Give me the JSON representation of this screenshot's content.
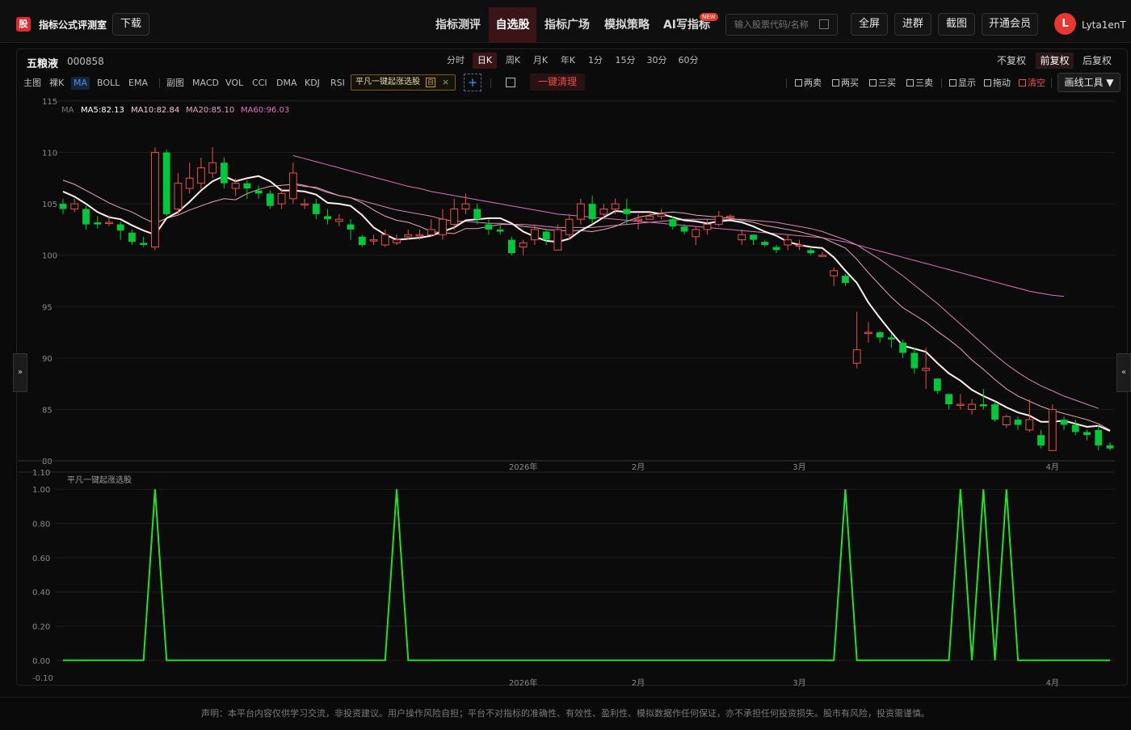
{
  "app": {
    "logo": "股",
    "title": "指标公式评测室",
    "download": "下载"
  },
  "nav": [
    {
      "label": "指标测评",
      "active": false
    },
    {
      "label": "自选股",
      "active": true
    },
    {
      "label": "指标广场",
      "active": false
    },
    {
      "label": "模拟策略",
      "active": false
    },
    {
      "label": "AI写指标",
      "active": false,
      "badge": "NEW"
    }
  ],
  "search": {
    "placeholder": "输入股票代码/名称"
  },
  "header_buttons": {
    "fullscreen": "全屏",
    "join_group": "进群",
    "screenshot": "截图",
    "membership": "开通会员"
  },
  "user": {
    "initial": "L",
    "name": "Lyta1enT"
  },
  "stock": {
    "name": "五粮液",
    "code": "000858"
  },
  "timeframes": [
    "分时",
    "日K",
    "周K",
    "月K",
    "年K",
    "1分",
    "15分",
    "30分",
    "60分"
  ],
  "active_timeframe": "日K",
  "adjust": [
    "不复权",
    "前复权",
    "后复权"
  ],
  "active_adjust": "前复权",
  "indicator_bar": {
    "main_label": "主图",
    "items": [
      "裸K",
      "MA",
      "BOLL",
      "EMA"
    ],
    "active": "MA",
    "sub_label": "副图",
    "sub_items": [
      "MACD",
      "VOL",
      "CCI",
      "DMA",
      "KDJ",
      "RSI"
    ],
    "formula_chip": "平凡一键起涨选股",
    "formula_tag": "自",
    "clear_all": "一键清理"
  },
  "checks": [
    {
      "label": "两卖",
      "red": false
    },
    {
      "label": "两买",
      "red": false
    },
    {
      "label": "三买",
      "red": false
    },
    {
      "label": "三卖",
      "red": false
    },
    {
      "label": "显示",
      "red": false
    },
    {
      "label": "拖动",
      "red": false
    },
    {
      "label": "清空",
      "red": true
    }
  ],
  "draw_tool": "画线工具 ▼",
  "handles": {
    "left": "»",
    "right": "«"
  },
  "colors": {
    "up": "#e8504a",
    "down": "#00c83a",
    "ma5": "#ffeeee",
    "ma10": "#e8a8b8",
    "ma20": "#d888b8",
    "ma60": "#e070c0",
    "signal": "#22e022"
  },
  "chart_data": [
    {
      "type": "candlestick",
      "yticks": [
        80,
        85,
        90,
        95,
        100,
        105,
        110,
        115
      ],
      "ylim": [
        80,
        115
      ],
      "x_labels": [
        {
          "index": 40,
          "label": "2026年"
        },
        {
          "index": 50,
          "label": "2月"
        },
        {
          "index": 64,
          "label": "3月"
        },
        {
          "index": 86,
          "label": "4月"
        }
      ],
      "ma_legend": {
        "label": "MA",
        "items": [
          "MA5:82.13",
          "MA10:82.84",
          "MA20:85.10",
          "MA60:96.03"
        ]
      },
      "candles": [
        [
          105.0,
          104.5,
          105.5,
          104.0
        ],
        [
          104.5,
          105.0,
          105.5,
          104.2
        ],
        [
          104.5,
          103.0,
          104.8,
          102.5
        ],
        [
          103.2,
          103.0,
          103.8,
          102.6
        ],
        [
          103.2,
          103.2,
          103.9,
          102.8
        ],
        [
          103.0,
          102.4,
          103.3,
          101.5
        ],
        [
          102.2,
          101.3,
          102.5,
          101.0
        ],
        [
          101.2,
          101.0,
          101.8,
          100.8
        ],
        [
          100.8,
          110.0,
          110.5,
          100.5
        ],
        [
          110.0,
          104.0,
          110.3,
          103.8
        ],
        [
          104.5,
          107.0,
          108.0,
          104.0
        ],
        [
          106.5,
          107.5,
          109.0,
          106.0
        ],
        [
          107.0,
          108.5,
          109.5,
          106.5
        ],
        [
          108.0,
          109.0,
          110.5,
          107.5
        ],
        [
          109.0,
          107.0,
          109.5,
          106.5
        ],
        [
          106.5,
          107.0,
          107.5,
          105.8
        ],
        [
          107.0,
          106.5,
          107.3,
          105.5
        ],
        [
          106.3,
          106.0,
          106.8,
          105.5
        ],
        [
          106.0,
          104.8,
          106.3,
          104.5
        ],
        [
          105.0,
          106.0,
          106.5,
          104.5
        ],
        [
          105.5,
          108.0,
          109.0,
          105.0
        ],
        [
          105.0,
          105.0,
          105.5,
          104.5
        ],
        [
          105.0,
          104.0,
          105.5,
          103.5
        ],
        [
          103.8,
          103.5,
          104.5,
          103.0
        ],
        [
          103.3,
          103.5,
          104.0,
          102.8
        ],
        [
          103.0,
          102.5,
          103.5,
          101.5
        ],
        [
          101.8,
          101.0,
          102.0,
          100.8
        ],
        [
          101.5,
          101.5,
          102.0,
          101.0
        ],
        [
          101.0,
          102.0,
          102.5,
          100.8
        ],
        [
          101.2,
          101.5,
          102.0,
          101.0
        ],
        [
          101.8,
          102.0,
          102.5,
          101.5
        ],
        [
          102.0,
          102.0,
          102.5,
          101.5
        ],
        [
          102.0,
          102.5,
          103.5,
          101.8
        ],
        [
          102.0,
          103.5,
          104.5,
          101.5
        ],
        [
          103.0,
          104.5,
          105.5,
          102.5
        ],
        [
          104.5,
          105.0,
          106.0,
          104.0
        ],
        [
          104.5,
          103.5,
          105.0,
          103.0
        ],
        [
          103.0,
          102.5,
          103.5,
          102.0
        ],
        [
          102.5,
          102.3,
          103.0,
          102.0
        ],
        [
          101.5,
          100.2,
          101.8,
          100.0
        ],
        [
          100.8,
          101.2,
          101.5,
          100.0
        ],
        [
          101.5,
          102.5,
          103.0,
          101.0
        ],
        [
          102.3,
          101.5,
          102.5,
          101.0
        ],
        [
          100.5,
          102.5,
          103.0,
          100.5
        ],
        [
          102.0,
          103.5,
          104.0,
          101.5
        ],
        [
          103.5,
          105.0,
          105.5,
          103.0
        ],
        [
          105.0,
          103.5,
          105.8,
          103.0
        ],
        [
          104.0,
          104.5,
          105.0,
          103.5
        ],
        [
          104.5,
          105.0,
          105.5,
          104.0
        ],
        [
          104.5,
          104.0,
          105.5,
          103.0
        ],
        [
          103.5,
          103.5,
          104.0,
          102.5
        ],
        [
          103.5,
          103.8,
          104.2,
          103.5
        ],
        [
          103.8,
          104.0,
          104.5,
          103.5
        ],
        [
          103.5,
          102.8,
          103.8,
          102.5
        ],
        [
          102.8,
          102.3,
          103.0,
          102.0
        ],
        [
          101.8,
          102.5,
          102.8,
          101.0
        ],
        [
          102.5,
          103.0,
          103.5,
          102.0
        ],
        [
          103.0,
          103.8,
          104.3,
          102.8
        ],
        [
          103.8,
          103.8,
          104.0,
          103.5
        ],
        [
          101.5,
          102.0,
          102.5,
          101.0
        ],
        [
          102.0,
          101.5,
          102.0,
          101.0
        ],
        [
          101.3,
          101.0,
          101.5,
          100.8
        ],
        [
          100.8,
          100.5,
          101.0,
          100.2
        ],
        [
          101.0,
          101.5,
          102.0,
          100.5
        ],
        [
          101.0,
          101.0,
          101.5,
          100.5
        ],
        [
          100.5,
          100.2,
          100.8,
          100.0
        ],
        [
          100.0,
          100.0,
          100.3,
          99.8
        ],
        [
          98.0,
          98.5,
          98.8,
          97.0
        ],
        [
          98.0,
          97.3,
          98.2,
          97.0
        ],
        [
          89.5,
          90.8,
          94.5,
          89.0
        ],
        [
          92.5,
          92.5,
          93.5,
          91.5
        ],
        [
          92.5,
          92.0,
          92.6,
          91.5
        ],
        [
          92.0,
          91.8,
          92.3,
          91.0
        ],
        [
          91.5,
          90.5,
          91.8,
          90.0
        ],
        [
          90.5,
          89.0,
          91.0,
          88.5
        ],
        [
          88.8,
          89.0,
          91.0,
          87.0
        ],
        [
          88.0,
          86.8,
          88.0,
          86.5
        ],
        [
          86.5,
          85.5,
          86.5,
          85.0
        ],
        [
          85.5,
          85.5,
          86.5,
          85.0
        ],
        [
          85.0,
          85.5,
          86.0,
          84.5
        ],
        [
          85.5,
          85.3,
          87.0,
          85.0
        ],
        [
          85.5,
          84.0,
          85.8,
          83.8
        ],
        [
          83.5,
          84.3,
          84.5,
          83.2
        ],
        [
          84.0,
          83.5,
          84.3,
          83.0
        ],
        [
          83.0,
          84.0,
          86.0,
          82.8
        ],
        [
          82.5,
          81.5,
          83.0,
          81.2
        ],
        [
          81.0,
          85.0,
          85.5,
          81.0
        ],
        [
          84.0,
          83.5,
          84.3,
          83.0
        ],
        [
          83.5,
          82.8,
          84.0,
          82.5
        ],
        [
          82.8,
          82.5,
          83.0,
          82.0
        ],
        [
          83.0,
          81.5,
          83.5,
          81.0
        ],
        [
          81.5,
          81.2,
          81.8,
          81.0
        ]
      ],
      "ma5": [
        106.2,
        105.7,
        105.0,
        104.2,
        103.7,
        103.5,
        102.9,
        102.4,
        102.0,
        103.6,
        104.2,
        105.2,
        106.3,
        107.2,
        107.7,
        107.2,
        107.5,
        107.7,
        107.2,
        106.3,
        106.3,
        106.2,
        105.9,
        105.1,
        105.0,
        104.8,
        103.9,
        102.7,
        102.0,
        101.5,
        101.6,
        101.7,
        101.9,
        102.3,
        102.7,
        103.4,
        103.5,
        103.6,
        103.6,
        103.1,
        102.3,
        101.8,
        101.4,
        101.3,
        101.6,
        102.4,
        103.0,
        103.7,
        104.3,
        104.2,
        104.2,
        104.2,
        104.0,
        103.7,
        103.4,
        103.3,
        103.1,
        103.3,
        103.4,
        103.2,
        102.8,
        102.3,
        101.9,
        101.3,
        101.0,
        100.8,
        100.7,
        99.8,
        98.5,
        97.3,
        95.4,
        93.9,
        92.5,
        91.2,
        90.9,
        90.6,
        89.5,
        88.5,
        87.8,
        86.9,
        86.3,
        85.8,
        85.2,
        84.7,
        84.4,
        83.8,
        83.8,
        83.9,
        83.6,
        83.3,
        83.4,
        82.9
      ],
      "ma10": [
        107.3,
        106.9,
        106.3,
        105.7,
        105.1,
        104.6,
        104.2,
        103.6,
        103.1,
        103.6,
        103.9,
        104.4,
        104.8,
        105.2,
        105.5,
        105.4,
        106.0,
        106.4,
        106.7,
        106.8,
        106.9,
        106.7,
        106.6,
        106.2,
        105.8,
        105.6,
        105.1,
        104.4,
        103.8,
        103.4,
        103.2,
        102.8,
        102.3,
        102.2,
        102.1,
        102.6,
        102.6,
        102.8,
        103.0,
        103.0,
        102.8,
        102.7,
        102.5,
        102.4,
        102.4,
        102.4,
        102.3,
        102.5,
        102.8,
        103.3,
        103.7,
        103.9,
        104.1,
        104.2,
        104.1,
        103.9,
        103.8,
        103.7,
        103.6,
        103.4,
        103.2,
        102.9,
        102.7,
        102.5,
        102.3,
        102.0,
        101.7,
        101.2,
        100.7,
        99.6,
        98.3,
        97.1,
        95.9,
        94.9,
        94.2,
        93.5,
        92.6,
        91.8,
        90.9,
        89.8,
        88.9,
        87.9,
        87.0,
        86.3,
        85.8,
        85.3,
        84.9,
        84.6,
        84.3,
        84.0,
        83.6,
        83.0
      ],
      "ma20": [
        null,
        null,
        null,
        null,
        null,
        null,
        null,
        null,
        null,
        null,
        null,
        null,
        null,
        null,
        null,
        null,
        null,
        null,
        null,
        null,
        107.0,
        106.8,
        106.5,
        106.1,
        105.8,
        105.6,
        105.3,
        105.0,
        104.7,
        104.4,
        104.2,
        104.0,
        103.8,
        103.5,
        103.3,
        103.3,
        103.2,
        103.1,
        103.1,
        103.0,
        103.0,
        102.9,
        102.8,
        102.7,
        102.7,
        102.7,
        102.7,
        102.8,
        102.9,
        103.0,
        103.1,
        103.2,
        103.3,
        103.4,
        103.5,
        103.5,
        103.5,
        103.5,
        103.5,
        103.5,
        103.4,
        103.3,
        103.2,
        103.0,
        102.8,
        102.6,
        102.3,
        101.9,
        101.5,
        101.0,
        100.3,
        99.6,
        98.8,
        98.0,
        97.1,
        96.2,
        95.3,
        94.3,
        93.3,
        92.3,
        91.3,
        90.3,
        89.4,
        88.6,
        87.9,
        87.3,
        86.8,
        86.3,
        85.9,
        85.5,
        85.1
      ],
      "ma60": [
        null,
        null,
        null,
        null,
        null,
        null,
        null,
        null,
        null,
        null,
        null,
        null,
        null,
        null,
        null,
        null,
        null,
        null,
        null,
        null,
        109.7,
        109.4,
        109.1,
        108.8,
        108.5,
        108.2,
        107.9,
        107.6,
        107.3,
        107.0,
        106.7,
        106.5,
        106.2,
        106.0,
        105.8,
        105.6,
        105.4,
        105.2,
        105.0,
        104.8,
        104.6,
        104.4,
        104.2,
        104.0,
        103.9,
        103.8,
        103.7,
        103.6,
        103.5,
        103.4,
        103.3,
        103.2,
        103.1,
        103.0,
        102.9,
        102.8,
        102.7,
        102.6,
        102.5,
        102.4,
        102.3,
        102.2,
        102.1,
        102.0,
        101.9,
        101.8,
        101.7,
        101.5,
        101.3,
        101.0,
        100.7,
        100.4,
        100.1,
        99.8,
        99.5,
        99.2,
        98.9,
        98.6,
        98.3,
        98.0,
        97.7,
        97.4,
        97.1,
        96.8,
        96.5,
        96.3,
        96.1,
        96.0
      ],
      "ma_first_index": {
        "ma20": 20,
        "ma60": 20
      }
    },
    {
      "type": "line",
      "title": "平凡一键起涨选股",
      "yticks": [
        -0.1,
        0.0,
        0.2,
        0.4,
        0.6,
        0.8,
        1.0,
        1.1
      ],
      "ytick_labels": [
        "-0.10",
        "0.00",
        "0.20",
        "0.40",
        "0.60",
        "0.80",
        "1.00",
        "1.10"
      ],
      "ylim": [
        -0.1,
        1.1
      ],
      "signal_indices": [
        8,
        29,
        68,
        78,
        80,
        82
      ]
    }
  ],
  "footer": "声明：本平台内容仅供学习交流，非投资建议。用户操作风险自担；平台不对指标的准确性、有效性、盈利性、模拟数据作任何保证，亦不承担任何投资损失。股市有风险，投资需谨慎。"
}
